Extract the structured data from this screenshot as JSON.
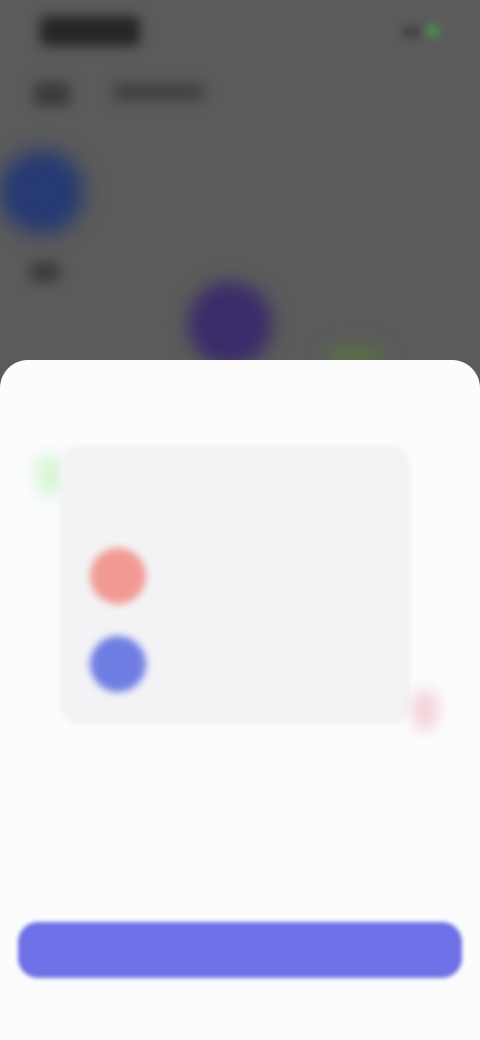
{
  "statusBar": {
    "time": ""
  },
  "sheet": {
    "cardTitle": "",
    "contacts": [
      {
        "name": "",
        "subtitle": "",
        "icon": "contact-avatar-icon",
        "color": "#f19a92"
      },
      {
        "name": "",
        "subtitle": "",
        "icon": "contact-avatar-icon",
        "color": "#6f7de3"
      }
    ],
    "headline": "",
    "description": "",
    "ctaLabel": ""
  },
  "colors": {
    "accent": "#6d70e6",
    "overlay": "#5a5a5a",
    "sheet": "#fcfcfd"
  }
}
